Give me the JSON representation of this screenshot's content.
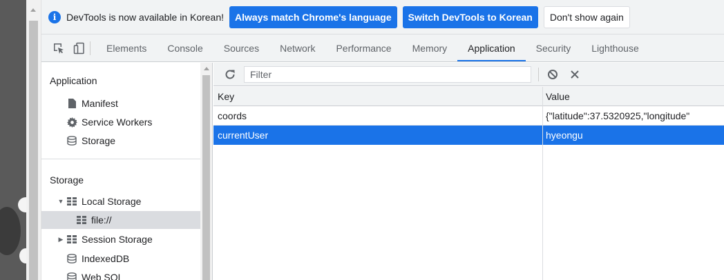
{
  "infobar": {
    "message": "DevTools is now available in Korean!",
    "btn_match": "Always match Chrome's language",
    "btn_switch": "Switch DevTools to Korean",
    "btn_dismiss": "Don't show again"
  },
  "tabs": [
    "Elements",
    "Console",
    "Sources",
    "Network",
    "Performance",
    "Memory",
    "Application",
    "Security",
    "Lighthouse"
  ],
  "active_tab": "Application",
  "sidebar": {
    "app_header": "Application",
    "app_items": [
      "Manifest",
      "Service Workers",
      "Storage"
    ],
    "storage_header": "Storage",
    "local_storage": "Local Storage",
    "local_origin": "file://",
    "session_storage": "Session Storage",
    "indexeddb": "IndexedDB",
    "websql": "Web SQL"
  },
  "toolbar": {
    "filter_placeholder": "Filter"
  },
  "grid": {
    "headers": {
      "key": "Key",
      "value": "Value"
    },
    "rows": [
      {
        "key": "coords",
        "value": "{\"latitude\":37.5320925,\"longitude\""
      },
      {
        "key": "currentUser",
        "value": "hyeongu"
      }
    ],
    "selected_row": 1
  },
  "colors": {
    "accent": "#1a73e8",
    "selected_row_text": "#ffffff"
  }
}
